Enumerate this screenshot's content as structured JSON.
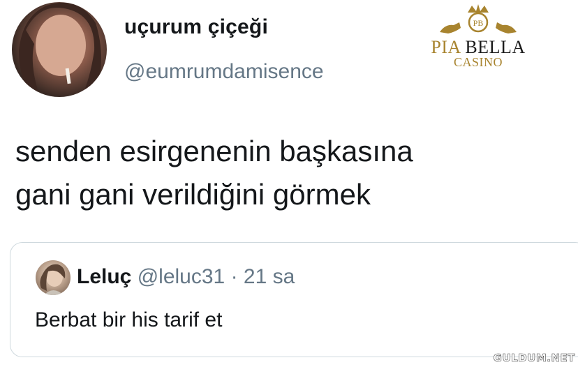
{
  "tweet": {
    "display_name": "uçurum çiçeği",
    "handle": "@eumrumdamisence",
    "text_lines": [
      "senden esirgenenin başkasına",
      "gani gani verildiğini görmek"
    ]
  },
  "quoted_tweet": {
    "name": "Leluç",
    "handle": "@leluc31",
    "separator": "·",
    "time": "21 sa",
    "text": "Berbat bir his tarif et"
  },
  "watermark": {
    "badge": "PB",
    "brand_part1": "PIA",
    "brand_part2": "BELLA",
    "subtitle": "CASINO",
    "gold_color": "#a8842f"
  },
  "site_watermark": "GULDUM.NET",
  "colors": {
    "text": "#14171a",
    "secondary_text": "#657786",
    "border": "#cfd9de"
  }
}
